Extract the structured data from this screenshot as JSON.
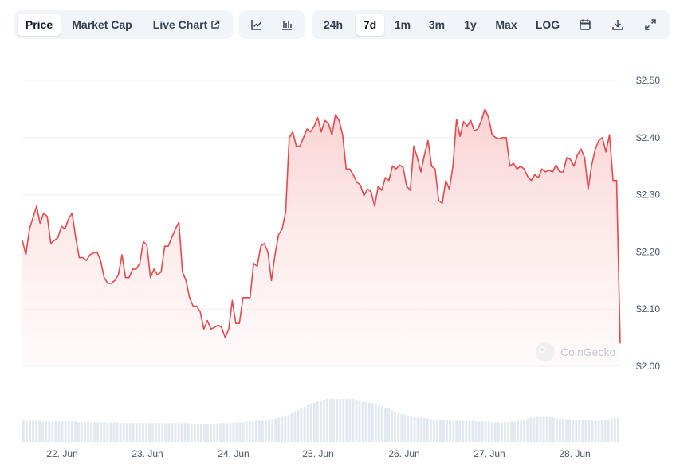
{
  "toolbar": {
    "metric_tabs": [
      {
        "label": "Price",
        "active": true
      },
      {
        "label": "Market Cap",
        "active": false
      },
      {
        "label": "Live Chart",
        "active": false
      }
    ],
    "view_icons": [
      "line-chart-icon",
      "ohlc-chart-icon"
    ],
    "range_tabs": [
      {
        "label": "24h",
        "active": false
      },
      {
        "label": "7d",
        "active": true
      },
      {
        "label": "1m",
        "active": false
      },
      {
        "label": "3m",
        "active": false
      },
      {
        "label": "1y",
        "active": false
      },
      {
        "label": "Max",
        "active": false
      },
      {
        "label": "LOG",
        "active": false
      }
    ],
    "tool_icons": [
      "calendar-icon",
      "download-icon",
      "expand-icon"
    ]
  },
  "watermark": "CoinGecko",
  "chart_data": {
    "type": "area",
    "line_color": "#e5484d",
    "fill_color": "#fde2e2",
    "grid": true,
    "ylim": [
      2.0,
      2.5
    ],
    "y_ticks": [
      "$2.50",
      "$2.40",
      "$2.30",
      "$2.20",
      "$2.10",
      "$2.00"
    ],
    "y_tick_values": [
      2.5,
      2.4,
      2.3,
      2.2,
      2.1,
      2.0
    ],
    "x_ticks": [
      "22. Jun",
      "23. Jun",
      "24. Jun",
      "25. Jun",
      "26. Jun",
      "27. Jun",
      "28. Jun"
    ],
    "series": [
      {
        "values": [
          2.22,
          2.195,
          2.24,
          2.26,
          2.28,
          2.25,
          2.268,
          2.262,
          2.215,
          2.22,
          2.225,
          2.245,
          2.24,
          2.258,
          2.268,
          2.225,
          2.19,
          2.19,
          2.185,
          2.195,
          2.198,
          2.2,
          2.185,
          2.155,
          2.145,
          2.145,
          2.15,
          2.16,
          2.195,
          2.155,
          2.155,
          2.17,
          2.17,
          2.18,
          2.218,
          2.212,
          2.155,
          2.17,
          2.16,
          2.165,
          2.21,
          2.21,
          2.225,
          2.24,
          2.252,
          2.165,
          2.15,
          2.12,
          2.105,
          2.105,
          2.095,
          2.065,
          2.08,
          2.065,
          2.068,
          2.072,
          2.068,
          2.05,
          2.065,
          2.115,
          2.075,
          2.075,
          2.12,
          2.12,
          2.12,
          2.18,
          2.175,
          2.21,
          2.215,
          2.2,
          2.15,
          2.195,
          2.23,
          2.24,
          2.27,
          2.4,
          2.41,
          2.385,
          2.385,
          2.4,
          2.415,
          2.41,
          2.42,
          2.435,
          2.41,
          2.43,
          2.425,
          2.405,
          2.44,
          2.43,
          2.405,
          2.345,
          2.345,
          2.335,
          2.322,
          2.317,
          2.298,
          2.31,
          2.305,
          2.28,
          2.315,
          2.308,
          2.33,
          2.325,
          2.35,
          2.345,
          2.352,
          2.348,
          2.315,
          2.308,
          2.385,
          2.365,
          2.34,
          2.37,
          2.395,
          2.35,
          2.345,
          2.29,
          2.285,
          2.325,
          2.31,
          2.35,
          2.432,
          2.402,
          2.428,
          2.42,
          2.43,
          2.412,
          2.415,
          2.43,
          2.45,
          2.435,
          2.405,
          2.4,
          2.398,
          2.4,
          2.4,
          2.35,
          2.355,
          2.345,
          2.35,
          2.345,
          2.332,
          2.325,
          2.335,
          2.33,
          2.345,
          2.34,
          2.343,
          2.34,
          2.352,
          2.34,
          2.34,
          2.365,
          2.362,
          2.35,
          2.37,
          2.38,
          2.365,
          2.31,
          2.352,
          2.38,
          2.395,
          2.4,
          2.375,
          2.405,
          2.325,
          2.325,
          2.04
        ]
      }
    ],
    "volume": {
      "color": "#e2e8f0",
      "values": [
        28,
        28,
        28,
        28,
        28,
        28,
        27,
        27,
        27,
        27,
        27,
        27,
        27,
        27,
        27,
        27,
        27,
        26,
        26,
        26,
        26,
        26,
        26,
        26,
        26,
        26,
        26,
        26,
        26,
        26,
        25,
        25,
        25,
        25,
        25,
        25,
        25,
        25,
        25,
        25,
        25,
        25,
        25,
        25,
        25,
        25,
        25,
        25,
        25,
        25,
        25,
        25,
        24,
        24,
        24,
        24,
        24,
        24,
        24,
        24,
        24,
        25,
        25,
        25,
        25,
        26,
        26,
        26,
        26,
        27,
        27,
        27,
        28,
        28,
        28,
        29,
        30,
        30,
        31,
        32,
        33,
        34,
        36,
        38,
        40,
        42,
        44,
        46,
        49,
        51,
        52,
        54,
        55,
        56,
        57,
        57,
        57,
        57,
        57,
        57,
        57,
        57,
        57,
        56,
        55,
        54,
        53,
        52,
        51,
        50,
        48,
        47,
        45,
        44,
        42,
        40,
        38,
        37,
        36,
        35,
        34,
        33,
        32,
        32,
        31,
        31,
        30,
        30,
        30,
        29,
        29,
        29,
        29,
        28,
        28,
        28,
        28,
        28,
        28,
        28,
        27,
        27,
        27,
        27,
        27,
        26,
        26,
        26,
        26,
        26,
        26,
        27,
        27,
        28,
        29,
        30,
        31,
        32,
        32,
        33,
        33,
        33,
        33,
        33,
        32,
        32,
        31,
        31,
        30,
        30,
        29,
        29,
        29,
        29,
        29,
        29,
        28,
        28,
        28,
        29,
        29,
        30,
        31,
        32,
        32
      ]
    }
  }
}
